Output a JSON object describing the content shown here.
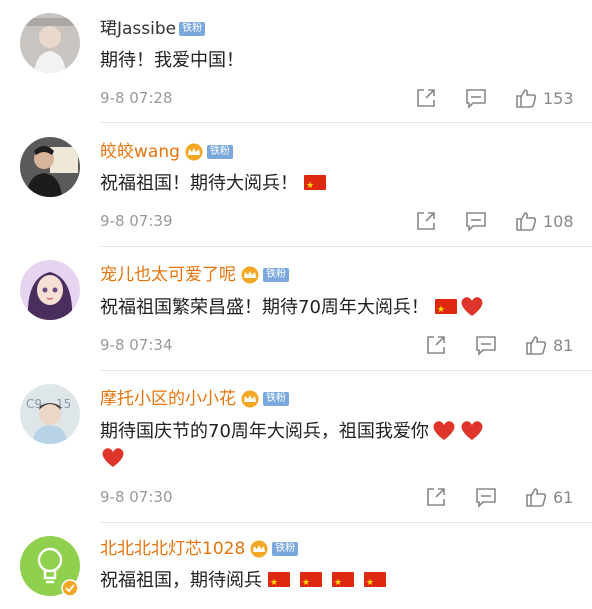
{
  "comments": [
    {
      "username": "珺Jassibe",
      "badge": "铁粉",
      "text": "期待！我爱中国！",
      "time": "9-8 07:28",
      "likes": "153",
      "avatar_icon": "avatar-photo-girl"
    },
    {
      "username": "皎皎wang",
      "badge": "铁粉",
      "text": "祝福祖国！期待大阅兵！",
      "time": "9-8 07:39",
      "likes": "108",
      "avatar_icon": "avatar-photo-man"
    },
    {
      "username": "宠儿也太可爱了呢",
      "badge": "铁粉",
      "text": "祝福祖国繁荣昌盛！期待70周年大阅兵！",
      "time": "9-8 07:34",
      "likes": "81",
      "avatar_icon": "avatar-anime-girl"
    },
    {
      "username": "摩托小区的小小花",
      "badge": "铁粉",
      "text": "期待国庆节的70周年大阅兵，祖国我爱你",
      "time": "9-8 07:30",
      "likes": "61",
      "avatar_icon": "avatar-photo-boy"
    },
    {
      "username": "北北北北灯芯1028",
      "badge": "铁粉",
      "text": "祝福祖国，期待阅兵",
      "avatar_icon": "avatar-lightbulb"
    }
  ],
  "icons": {
    "share": "share-icon",
    "comment": "comment-icon",
    "like": "like-icon",
    "crown": "crown-icon",
    "flag": "china-flag-emoji",
    "heart": "red-heart-emoji"
  },
  "colors": {
    "vip_name": "#e8740c",
    "badge_bg": "#7aa8dd",
    "flag_red": "#de2910",
    "heart_red": "#e0352b"
  }
}
